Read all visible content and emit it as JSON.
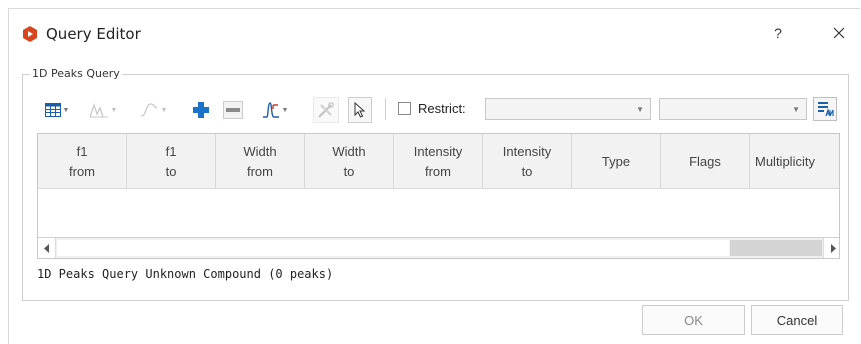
{
  "window": {
    "title": "Query Editor",
    "help_label": "?",
    "close_label": "✕"
  },
  "group": {
    "legend": "1D Peaks Query"
  },
  "toolbar": {
    "restrict_label": "Restrict:",
    "restrict_checked": false,
    "combo1_value": "",
    "combo2_value": ""
  },
  "table": {
    "columns": [
      {
        "line1": "f1",
        "line2": "from"
      },
      {
        "line1": "f1",
        "line2": "to"
      },
      {
        "line1": "Width",
        "line2": "from"
      },
      {
        "line1": "Width",
        "line2": "to"
      },
      {
        "line1": "Intensity",
        "line2": "from"
      },
      {
        "line1": "Intensity",
        "line2": "to"
      },
      {
        "line1": "Type",
        "line2": ""
      },
      {
        "line1": "Flags",
        "line2": ""
      },
      {
        "line1": "Multiplicity",
        "line2": ""
      }
    ],
    "rows": []
  },
  "status_text": "1D Peaks Query Unknown Compound (0 peaks)",
  "buttons": {
    "ok": "OK",
    "cancel": "Cancel"
  },
  "colors": {
    "app_icon": "#d9451f",
    "accent_blue": "#1a73c8"
  }
}
